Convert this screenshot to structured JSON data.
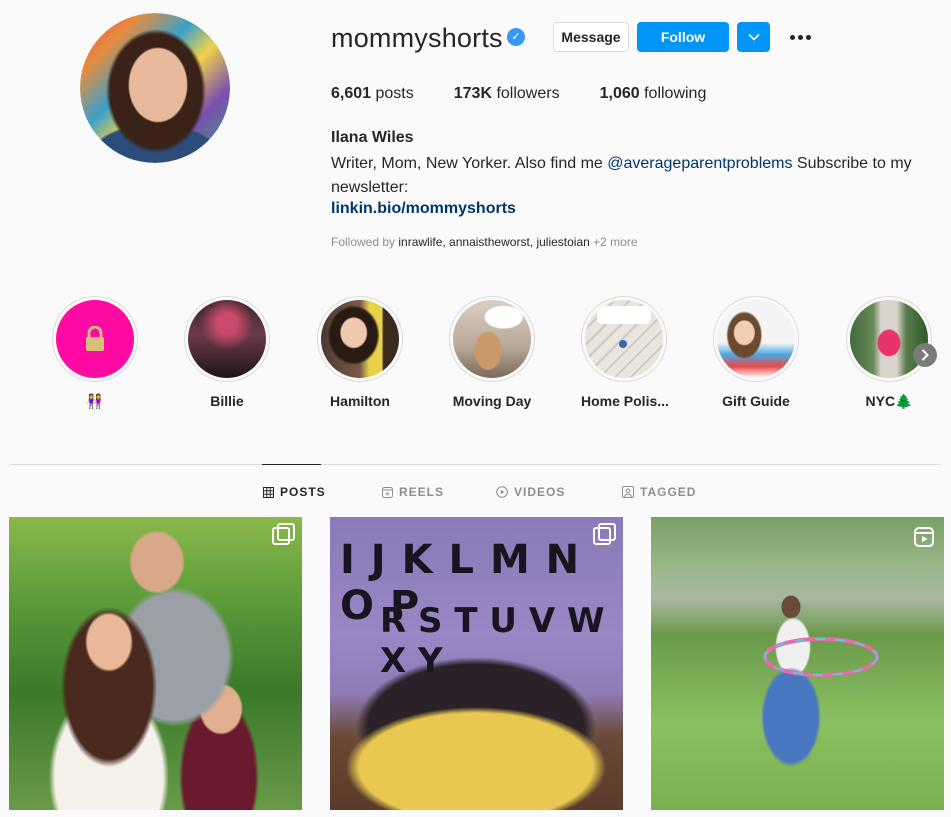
{
  "profile": {
    "username": "mommyshorts",
    "verified_icon": "verified-badge-icon",
    "message_label": "Message",
    "follow_label": "Follow",
    "posts_count": "6,601",
    "posts_label": "posts",
    "followers_count": "173K",
    "followers_label": "followers",
    "following_count": "1,060",
    "following_label": "following",
    "full_name": "Ilana Wiles",
    "bio_prefix": "Writer, Mom, New Yorker. Also find me ",
    "bio_mention": "@averageparentproblems",
    "bio_suffix": " Subscribe to my newsletter:",
    "link": "linkin.bio/mommyshorts",
    "followed_by_prefix": "Followed by ",
    "followed_by_names": "inrawlife, annaistheworst, juliestoian",
    "followed_by_more": " +2 more"
  },
  "highlights": [
    {
      "label": "👭",
      "icon": "lock-icon"
    },
    {
      "label": "Billie"
    },
    {
      "label": "Hamilton"
    },
    {
      "label": "Moving Day"
    },
    {
      "label": "Home Polis..."
    },
    {
      "label": "Gift Guide"
    },
    {
      "label": "NYC🌲"
    }
  ],
  "tabs": [
    {
      "label": "POSTS",
      "icon": "grid-icon",
      "active": true
    },
    {
      "label": "REELS",
      "icon": "reels-icon",
      "active": false
    },
    {
      "label": "VIDEOS",
      "icon": "video-icon",
      "active": false
    },
    {
      "label": "TAGGED",
      "icon": "tagged-icon",
      "active": false
    }
  ],
  "posts": [
    {
      "type": "carousel",
      "icon": "carousel-icon"
    },
    {
      "type": "carousel",
      "icon": "carousel-icon",
      "overlay_text_top": "I J K L M N O P",
      "overlay_text_bottom": "R S T U V W X Y"
    },
    {
      "type": "reel",
      "icon": "reel-icon"
    }
  ],
  "colors": {
    "accent": "#0095f6",
    "link": "#00376b",
    "secondary_text": "#8e8e8e",
    "highlight_pink": "#ff0aa2"
  }
}
